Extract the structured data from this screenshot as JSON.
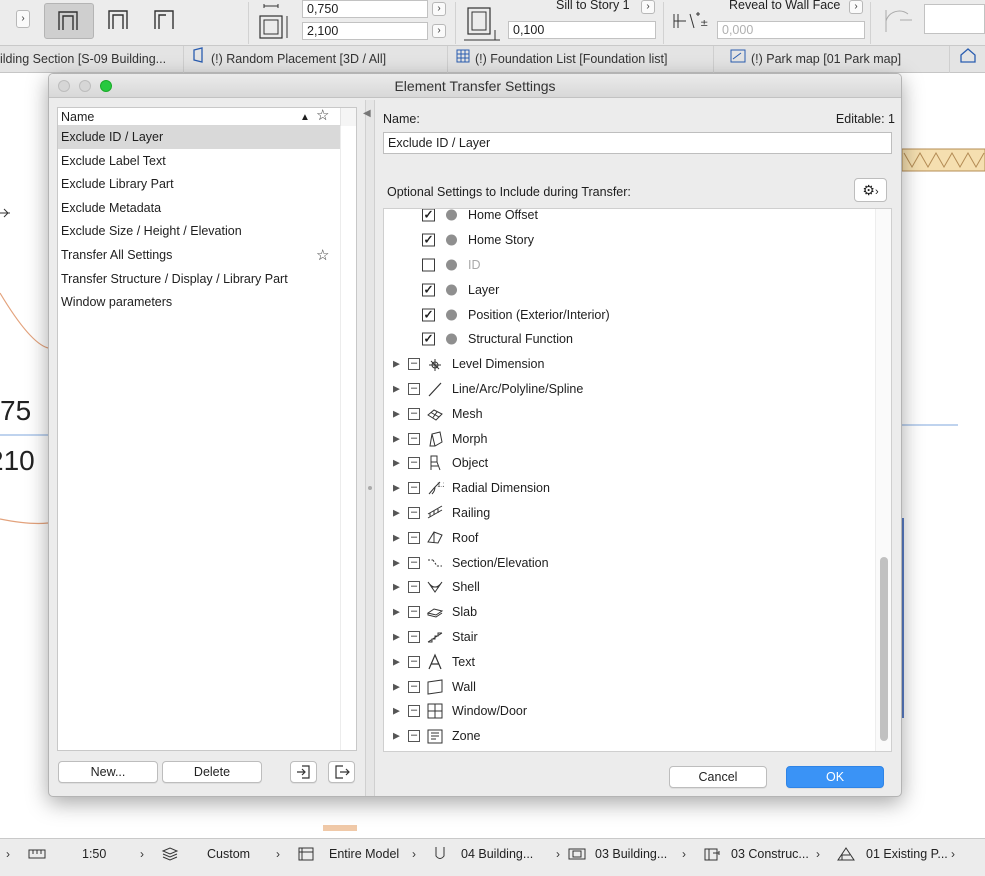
{
  "toolbar": {
    "field_top": "0,750",
    "field_bottom": "2,100",
    "sill_label": "Sill to Story 1",
    "sill_value": "0,100",
    "reveal_label": "Reveal to Wall Face",
    "reveal_value": "0,000"
  },
  "tabs": [
    {
      "label": "ilding Section [S-09 Building...",
      "icon": "section-icon"
    },
    {
      "label": "(!) Random Placement [3D / All]",
      "icon": "3d-window-icon"
    },
    {
      "label": "(!) Foundation List [Foundation list]",
      "icon": "list-grid-icon"
    },
    {
      "label": "(!) Park map [01 Park map]",
      "icon": "layout-icon"
    }
  ],
  "drawing": {
    "num1": "75",
    "num2": "210"
  },
  "dialog": {
    "title": "Element Transfer Settings",
    "list_header": "Name",
    "list_items": [
      {
        "label": "Exclude ID / Layer",
        "selected": true,
        "favorite": false
      },
      {
        "label": "Exclude Label Text",
        "selected": false,
        "favorite": false
      },
      {
        "label": "Exclude Library Part",
        "selected": false,
        "favorite": false
      },
      {
        "label": "Exclude Metadata",
        "selected": false,
        "favorite": false
      },
      {
        "label": "Exclude Size / Height / Elevation",
        "selected": false,
        "favorite": false
      },
      {
        "label": "Transfer All Settings",
        "selected": false,
        "favorite": true
      },
      {
        "label": "Transfer Structure / Display / Library Part",
        "selected": false,
        "favorite": false
      },
      {
        "label": "Window parameters",
        "selected": false,
        "favorite": false
      }
    ],
    "new_button": "New...",
    "delete_button": "Delete",
    "name_label": "Name:",
    "editable_label": "Editable: 1",
    "name_value": "Exclude ID / Layer",
    "optional_label": "Optional Settings to Include during Transfer:",
    "settings": [
      {
        "label": "Home Offset",
        "checked": true
      },
      {
        "label": "Home Story",
        "checked": true
      },
      {
        "label": "ID",
        "checked": false
      },
      {
        "label": "Layer",
        "checked": true
      },
      {
        "label": "Position (Exterior/Interior)",
        "checked": true
      },
      {
        "label": "Structural Function",
        "checked": true
      }
    ],
    "tools": [
      {
        "label": "Level Dimension",
        "icon": "level-dimension-icon"
      },
      {
        "label": "Line/Arc/Polyline/Spline",
        "icon": "line-icon"
      },
      {
        "label": "Mesh",
        "icon": "mesh-icon"
      },
      {
        "label": "Morph",
        "icon": "morph-icon"
      },
      {
        "label": "Object",
        "icon": "object-icon"
      },
      {
        "label": "Radial Dimension",
        "icon": "radial-dimension-icon"
      },
      {
        "label": "Railing",
        "icon": "railing-icon"
      },
      {
        "label": "Roof",
        "icon": "roof-icon"
      },
      {
        "label": "Section/Elevation",
        "icon": "section-elevation-icon"
      },
      {
        "label": "Shell",
        "icon": "shell-icon"
      },
      {
        "label": "Slab",
        "icon": "slab-icon"
      },
      {
        "label": "Stair",
        "icon": "stair-icon"
      },
      {
        "label": "Text",
        "icon": "text-icon"
      },
      {
        "label": "Wall",
        "icon": "wall-icon"
      },
      {
        "label": "Window/Door",
        "icon": "window-door-icon"
      },
      {
        "label": "Zone",
        "icon": "zone-icon"
      }
    ],
    "cancel_button": "Cancel",
    "ok_button": "OK"
  },
  "statusbar": {
    "scale": "1:50",
    "layer_combo": "Custom",
    "model_view": "Entire Model",
    "item1": "04 Building...",
    "item2": "03 Building...",
    "item3": "03 Construc...",
    "item4": "01 Existing P..."
  },
  "colors": {
    "accent": "#3a93f6",
    "selection": "#d9d9d9",
    "traffic_green": "#27c93f"
  }
}
